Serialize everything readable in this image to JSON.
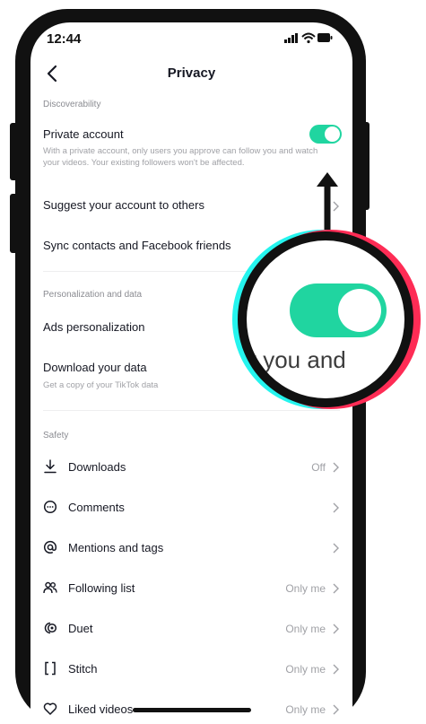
{
  "status_bar": {
    "time": "12:44"
  },
  "header": {
    "title": "Privacy"
  },
  "discoverability": {
    "section": "Discoverability",
    "private_account": {
      "label": "Private account",
      "desc": "With a private account, only users you approve can follow you and watch your videos. Your existing followers won't be affected.",
      "enabled": true
    },
    "suggest": "Suggest your account to others",
    "sync": "Sync contacts and Facebook friends"
  },
  "personalization": {
    "section": "Personalization and data",
    "ads": "Ads personalization",
    "download": "Download your data",
    "download_desc": "Get a copy of your TikTok data"
  },
  "safety": {
    "section": "Safety",
    "items": [
      {
        "label": "Downloads",
        "value": "Off",
        "icon": "download-icon"
      },
      {
        "label": "Comments",
        "value": "",
        "icon": "comment-icon"
      },
      {
        "label": "Mentions and tags",
        "value": "",
        "icon": "at-icon"
      },
      {
        "label": "Following list",
        "value": "Only me",
        "icon": "people-icon"
      },
      {
        "label": "Duet",
        "value": "Only me",
        "icon": "duet-icon"
      },
      {
        "label": "Stitch",
        "value": "Only me",
        "icon": "stitch-icon"
      },
      {
        "label": "Liked videos",
        "value": "Only me",
        "icon": "heart-icon"
      }
    ]
  },
  "magnifier": {
    "text": "y you and"
  },
  "colors": {
    "accent": "#20d5a0",
    "cyan": "#25f4ee",
    "red": "#fe2c55"
  }
}
